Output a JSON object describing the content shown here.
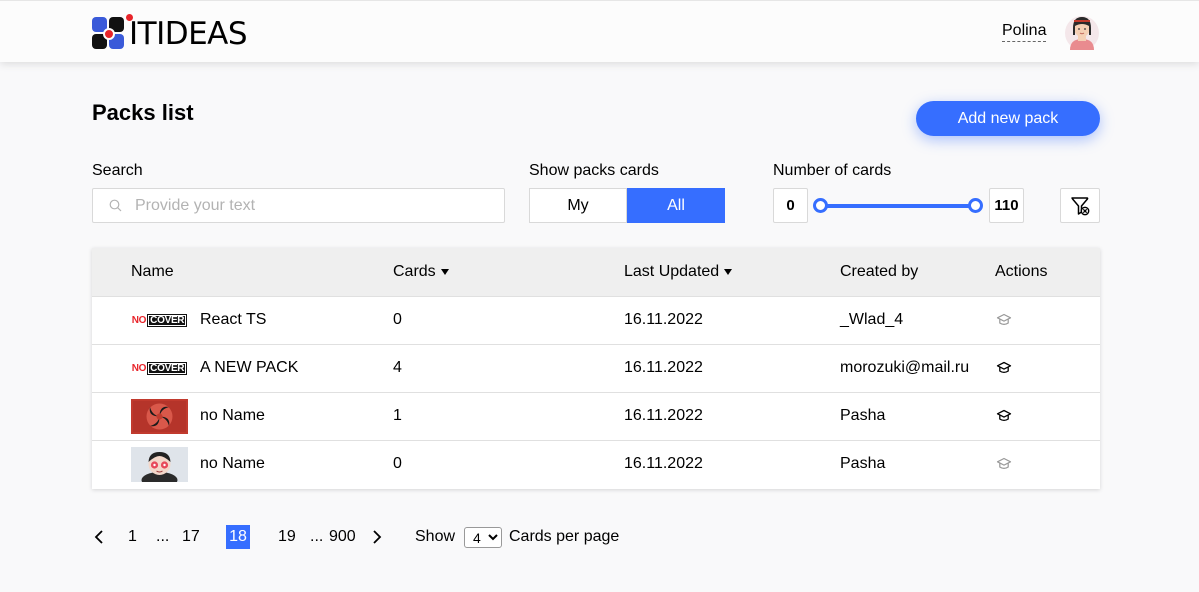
{
  "header": {
    "logo_text": "ITIDEAS",
    "user_name": "Polina"
  },
  "page": {
    "title": "Packs list",
    "add_button": "Add new pack"
  },
  "filters": {
    "search_label": "Search",
    "search_placeholder": "Provide your text",
    "search_value": "",
    "show_label": "Show packs cards",
    "toggle_my": "My",
    "toggle_all": "All",
    "toggle_selected": "All",
    "number_label": "Number of cards",
    "range_min": "0",
    "range_max": "110"
  },
  "table": {
    "columns": {
      "name": "Name",
      "cards": "Cards",
      "last_updated": "Last Updated",
      "created_by": "Created by",
      "actions": "Actions"
    },
    "rows": [
      {
        "cover": "no-cover",
        "name": "React TS",
        "cards": "0",
        "updated": "16.11.2022",
        "created_by": "_Wlad_4",
        "action_icon": "learn-icon",
        "action_enabled": false
      },
      {
        "cover": "no-cover",
        "name": "A NEW PACK",
        "cards": "4",
        "updated": "16.11.2022",
        "created_by": "morozuki@mail.ru",
        "action_icon": "learn-icon",
        "action_enabled": true
      },
      {
        "cover": "red-swirl-image",
        "name": "no Name",
        "cards": "1",
        "updated": "16.11.2022",
        "created_by": "Pasha",
        "action_icon": "learn-icon",
        "action_enabled": true
      },
      {
        "cover": "cartoon-face-image",
        "name": "no Name",
        "cards": "0",
        "updated": "16.11.2022",
        "created_by": "Pasha",
        "action_icon": "learn-icon",
        "action_enabled": false
      }
    ],
    "no_cover_text": [
      "NO",
      "COVER"
    ]
  },
  "pagination": {
    "pages": [
      "1",
      "...",
      "17",
      "18",
      "19",
      "...",
      "900"
    ],
    "current": "18",
    "show_label": "Show",
    "per_page_value": "4",
    "per_page_suffix": "Cards per page"
  },
  "colors": {
    "accent": "#366eff",
    "logo_red": "#e8242a"
  }
}
